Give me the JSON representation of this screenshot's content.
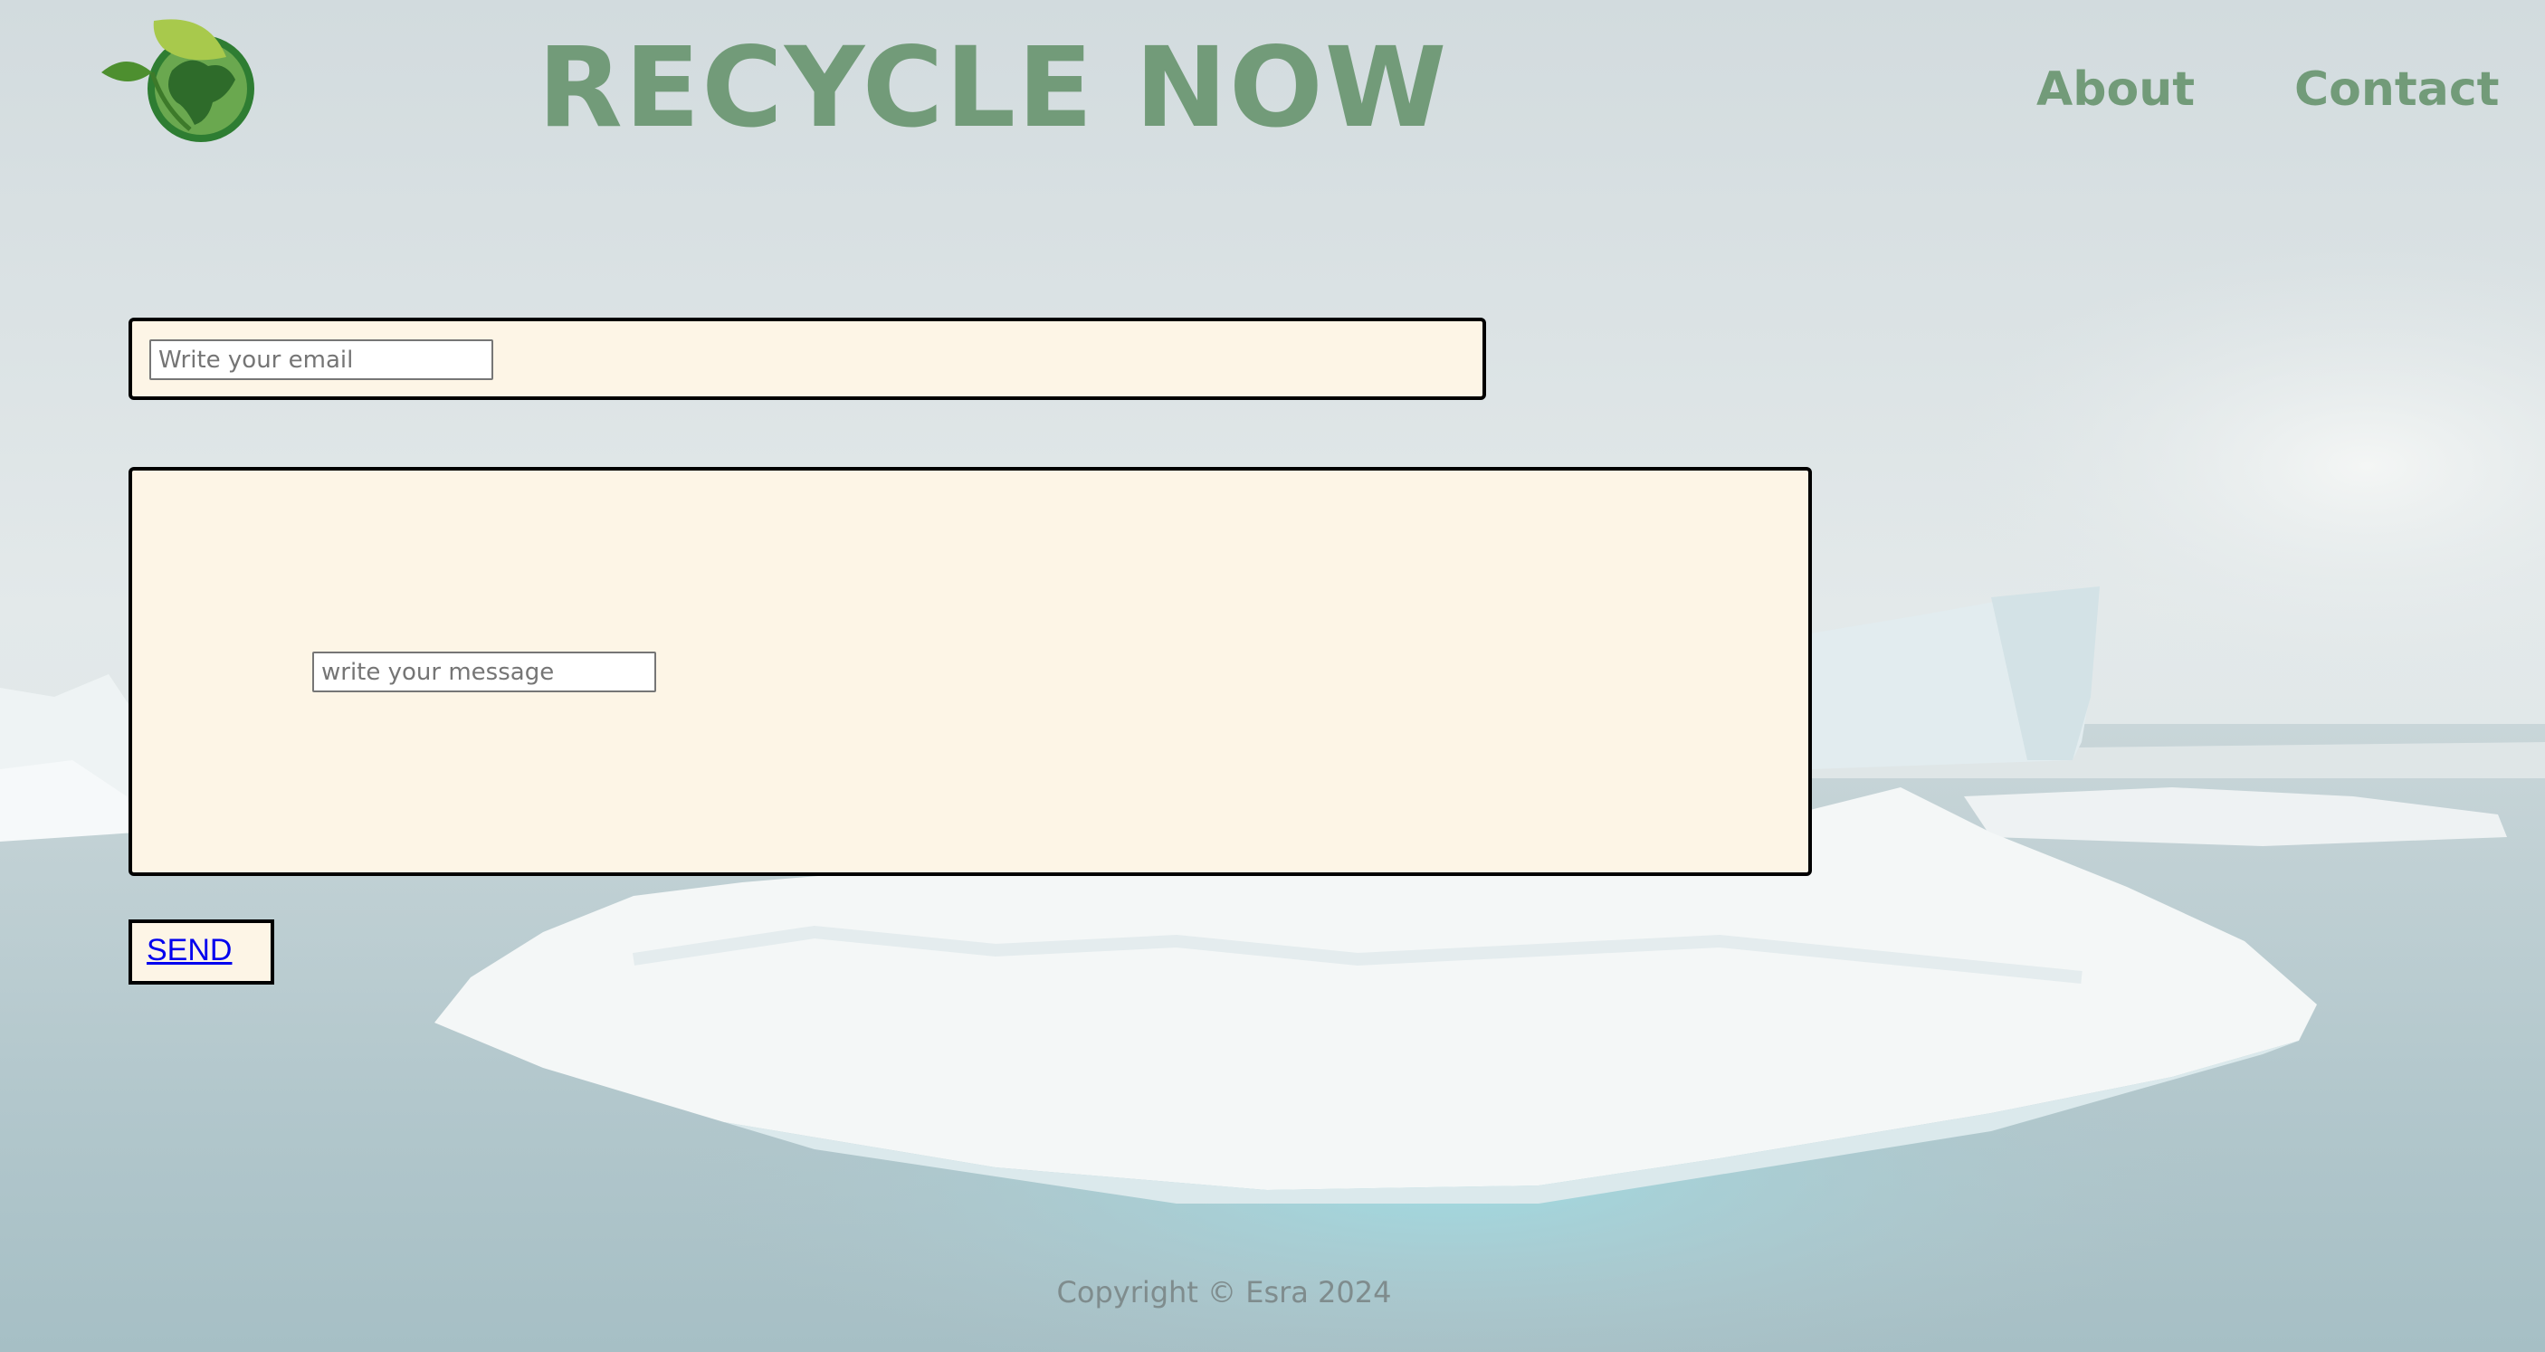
{
  "header": {
    "title": "RECYCLE NOW",
    "logo_icon": "globe-leaf-icon",
    "nav": [
      {
        "label": "About"
      },
      {
        "label": "Contact"
      }
    ]
  },
  "form": {
    "email": {
      "value": "",
      "placeholder": "Write your email"
    },
    "message": {
      "value": "",
      "placeholder": "write your message"
    },
    "send_label": "SEND"
  },
  "footer": {
    "text": "Copyright © Esra 2024"
  },
  "colors": {
    "brand_green": "#729b79",
    "panel_background": "#fdf5e6",
    "link_blue": "#0000ee",
    "footer_text": "#7f8c8d"
  }
}
